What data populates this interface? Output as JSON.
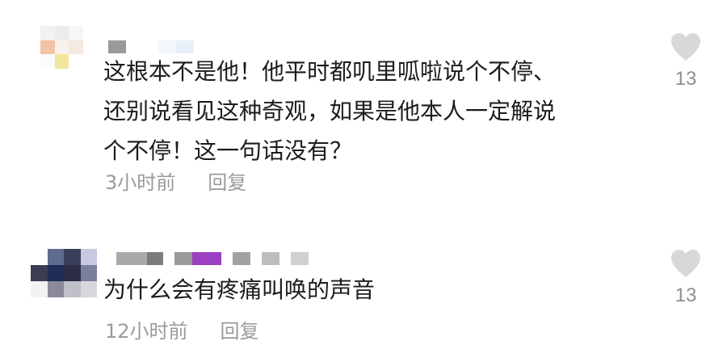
{
  "colors": {
    "text": "#1c1c1c",
    "meta": "#9a9a9a",
    "like_icon": "#d8d8d8",
    "like_count": "#8e8e8e"
  },
  "comments": [
    {
      "lines": [
        "这根本不是他！他平时都叽里呱啦说个不停、",
        "还别说看见这种奇观，如果是他本人一定解说",
        "个不停！这一句话没有？"
      ],
      "time": "3小时前",
      "reply_label": "回复",
      "like_icon": "heart-icon",
      "likes": "13"
    },
    {
      "lines": [
        "为什么会有疼痛叫唤的声音"
      ],
      "time": "12小时前",
      "reply_label": "回复",
      "like_icon": "heart-icon",
      "likes": "13"
    }
  ]
}
